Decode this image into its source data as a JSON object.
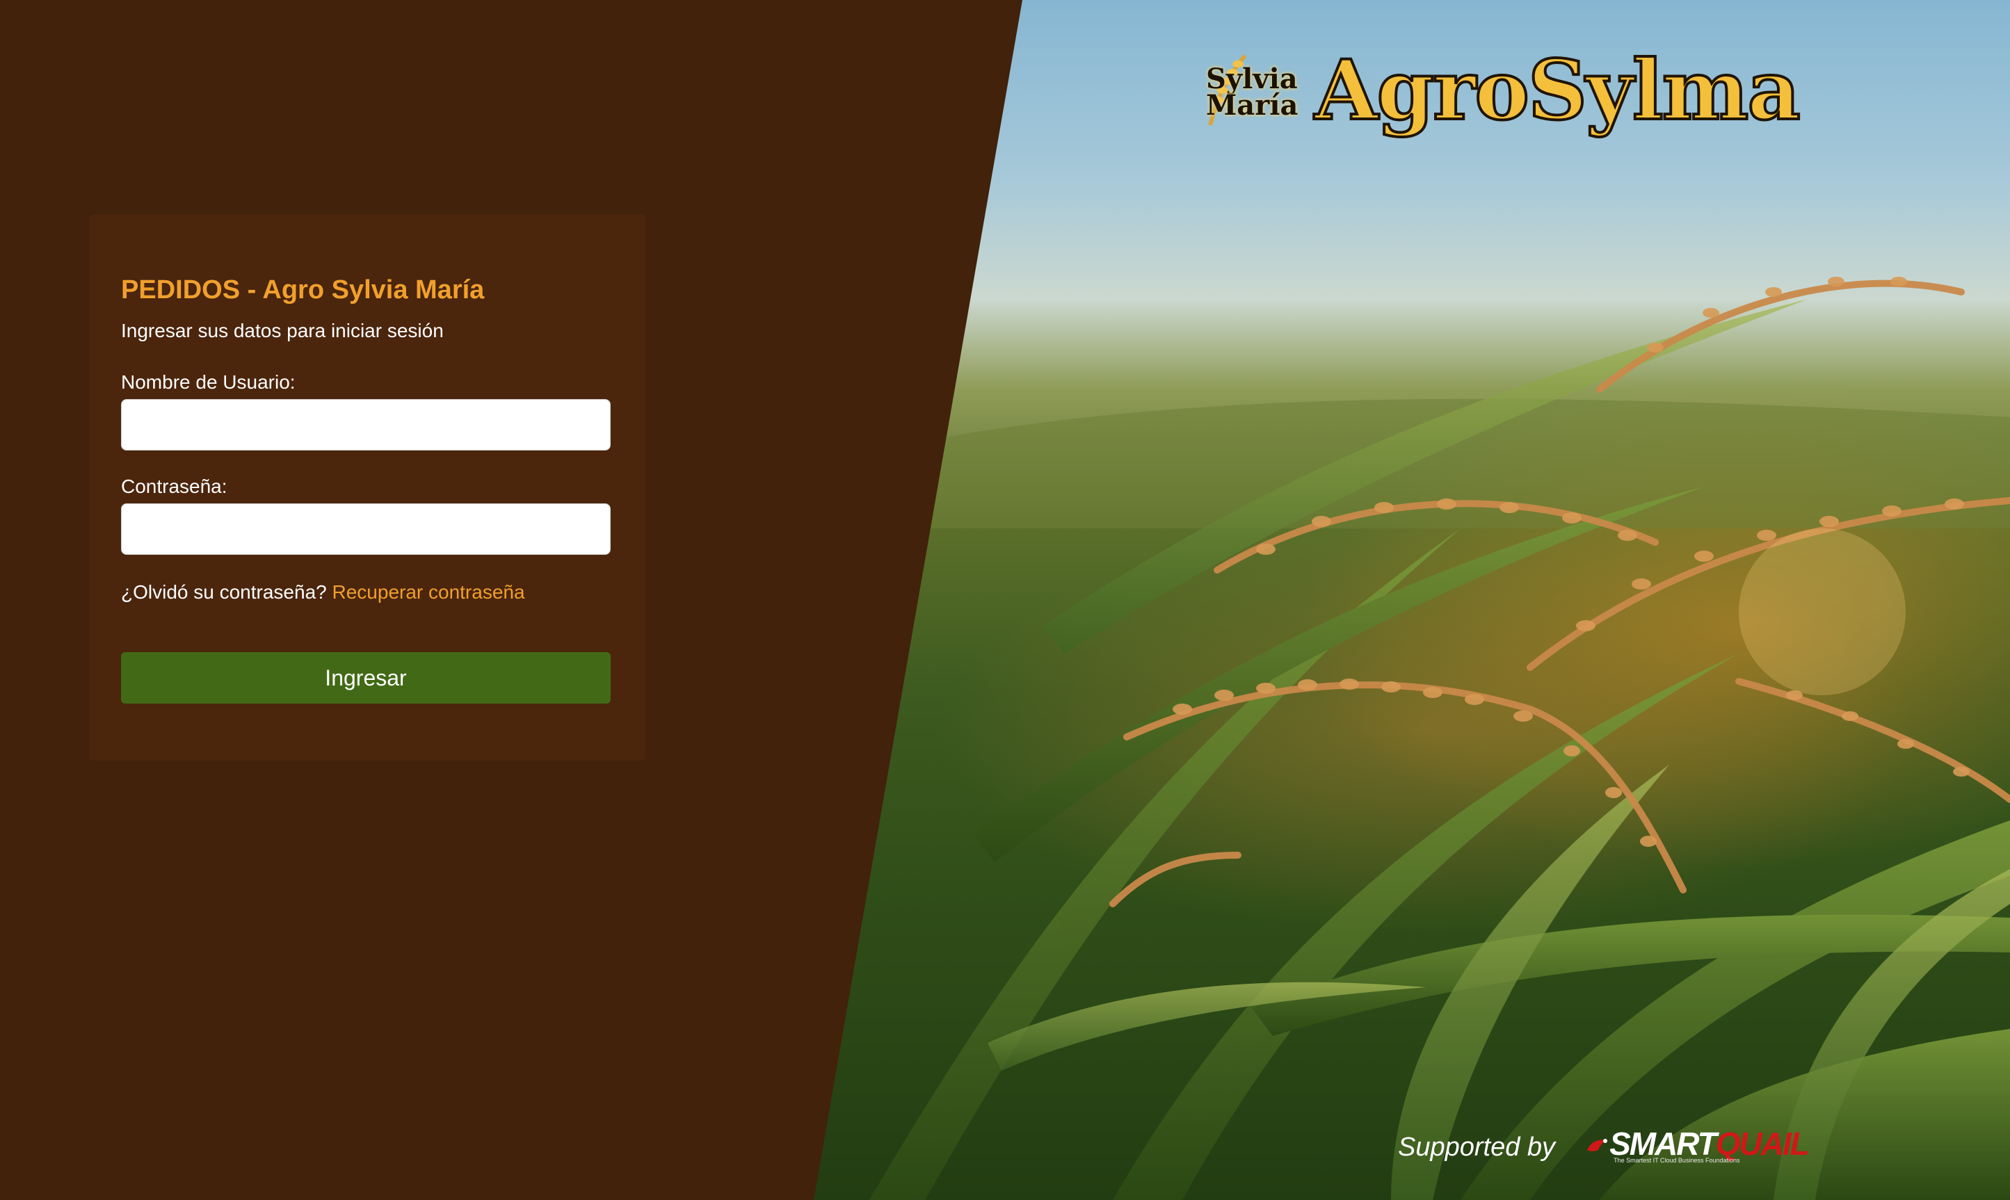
{
  "login": {
    "title": "PEDIDOS - Agro Sylvia María",
    "subtitle": "Ingresar sus datos para iniciar sesión",
    "username_label": "Nombre de Usuario:",
    "username_value": "",
    "password_label": "Contraseña:",
    "password_value": "",
    "forgot_text": "¿Olvidó su contraseña?",
    "recover_link": "Recuperar contraseña",
    "submit_label": "Ingresar"
  },
  "brand": {
    "emblem_line1": "Sylvia",
    "emblem_line2": "María",
    "wordmark": "AgroSylma"
  },
  "footer": {
    "supported_label": "Supported by",
    "partner_name_part1": "SMART",
    "partner_name_part2": "QUAIL",
    "partner_tagline": "The Smartest IT Cloud Business Foundations"
  },
  "colors": {
    "page_background": "#42220a",
    "card_background": "#4b250c",
    "accent_orange": "#f0a02c",
    "button_green": "#426a16",
    "logo_gold": "#f4bf3a",
    "partner_red": "#d01818"
  },
  "icons": {
    "logo_emblem": "rice-stalk-emblem-icon",
    "partner_mark": "smartquail-bird-icon"
  }
}
